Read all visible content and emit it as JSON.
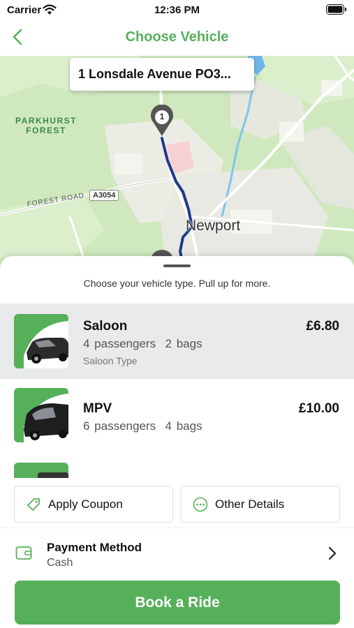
{
  "status_bar": {
    "carrier": "Carrier",
    "time": "12:36 PM"
  },
  "nav": {
    "title": "Choose Vehicle",
    "back_icon": "chevron-left-icon"
  },
  "map": {
    "pickup_address": "1 Lonsdale Avenue PO3...",
    "labels": {
      "forest": "PARKHURST\nFOREST",
      "forest_line1": "PARKHURST",
      "forest_line2": "FOREST",
      "road": "FOREST ROAD",
      "road_shield": "A3054",
      "town": "Newport"
    },
    "pin_number": "1"
  },
  "sheet": {
    "hint": "Choose your vehicle type. Pull up for more.",
    "vehicles": [
      {
        "name": "Saloon",
        "passengers": "4 passengers",
        "bags": "2 bags",
        "type": "Saloon Type",
        "price": "£6.80",
        "selected": true
      },
      {
        "name": "MPV",
        "passengers": "6 passengers",
        "bags": "4 bags",
        "type": "",
        "price": "£10.00",
        "selected": false
      }
    ]
  },
  "actions": {
    "coupon": "Apply Coupon",
    "details": "Other Details"
  },
  "payment": {
    "label": "Payment Method",
    "value": "Cash"
  },
  "book_button": "Book a Ride",
  "colors": {
    "brand_green": "#56b05a",
    "route_blue": "#1f3a8a",
    "selected_row": "#e9eaec"
  }
}
